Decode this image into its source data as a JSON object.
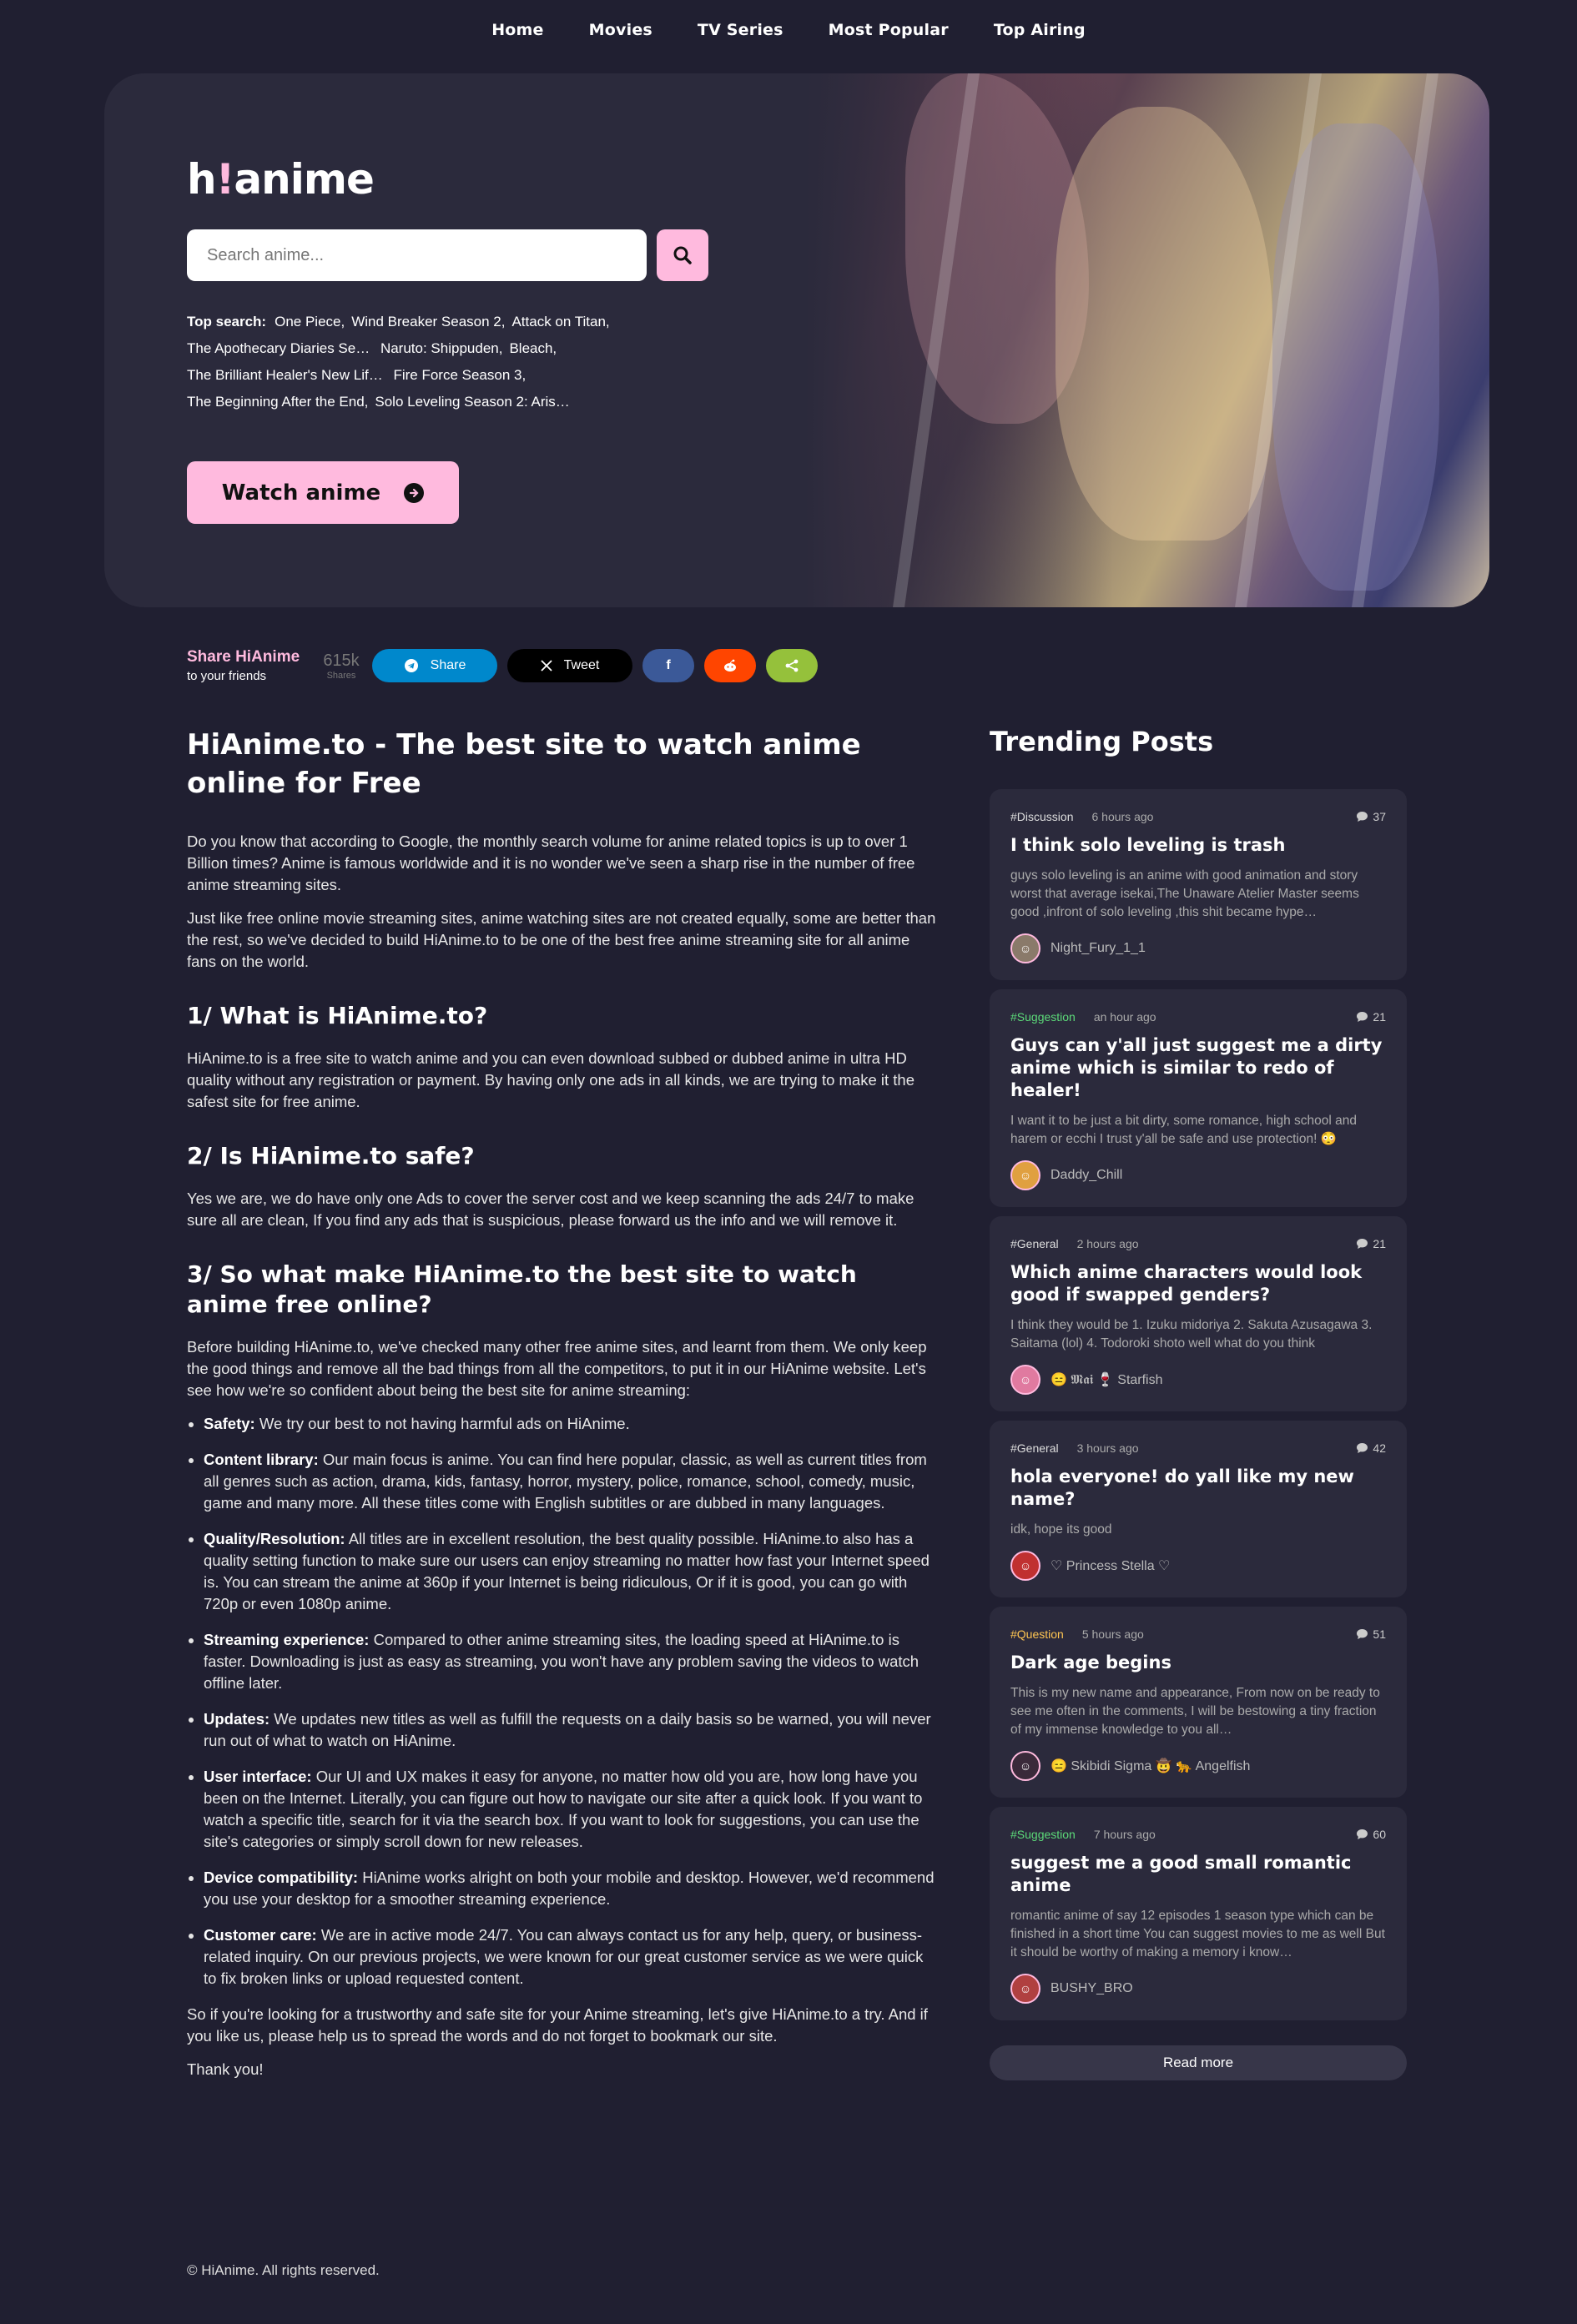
{
  "nav": {
    "items": [
      "Home",
      "Movies",
      "TV Series",
      "Most Popular",
      "Top Airing"
    ]
  },
  "hero": {
    "logo_h": "h",
    "logo_bang": "!",
    "logo_rest": "anime",
    "search_placeholder": "Search anime...",
    "top_search_label": "Top search:",
    "top_search": [
      "One Piece,",
      "Wind Breaker Season 2,",
      "Attack on Titan,",
      "The Apothecary Diaries Se…",
      "Naruto: Shippuden,",
      "Bleach,",
      "The Brilliant Healer's New Lif…",
      "Fire Force Season 3,",
      "The Beginning After the End,",
      "Solo Leveling Season 2: Aris…"
    ],
    "watch_label": "Watch anime"
  },
  "share": {
    "title": "Share HiAnime",
    "subtitle": "to your friends",
    "count": "615k",
    "count_label": "Shares",
    "telegram": "Share",
    "tweet": "Tweet"
  },
  "article": {
    "h1": "HiAnime.to - The best site to watch anime online for Free",
    "p1": "Do you know that according to Google, the monthly search volume for anime related topics is up to over 1 Billion times? Anime is famous worldwide and it is no wonder we've seen a sharp rise in the number of free anime streaming sites.",
    "p2": "Just like free online movie streaming sites, anime watching sites are not created equally, some are better than the rest, so we've decided to build HiAnime.to to be one of the best free anime streaming site for all anime fans on the world.",
    "h2a": "1/ What is HiAnime.to?",
    "p3": "HiAnime.to is a free site to watch anime and you can even download subbed or dubbed anime in ultra HD quality without any registration or payment. By having only one ads in all kinds, we are trying to make it the safest site for free anime.",
    "h2b": "2/ Is HiAnime.to safe?",
    "p4": "Yes we are, we do have only one Ads to cover the server cost and we keep scanning the ads 24/7 to make sure all are clean, If you find any ads that is suspicious, please forward us the info and we will remove it.",
    "h2c": "3/ So what make HiAnime.to the best site to watch anime free online?",
    "p5": "Before building HiAnime.to, we've checked many other free anime sites, and learnt from them. We only keep the good things and remove all the bad things from all the competitors, to put it in our HiAnime website. Let's see how we're so confident about being the best site for anime streaming:",
    "bullets": [
      {
        "k": "Safety:",
        "v": " We try our best to not having harmful ads on HiAnime."
      },
      {
        "k": "Content library:",
        "v": " Our main focus is anime. You can find here popular, classic, as well as current titles from all genres such as action, drama, kids, fantasy, horror, mystery, police, romance, school, comedy, music, game and many more. All these titles come with English subtitles or are dubbed in many languages."
      },
      {
        "k": "Quality/Resolution:",
        "v": " All titles are in excellent resolution, the best quality possible. HiAnime.to also has a quality setting function to make sure our users can enjoy streaming no matter how fast your Internet speed is. You can stream the anime at 360p if your Internet is being ridiculous, Or if it is good, you can go with 720p or even 1080p anime."
      },
      {
        "k": "Streaming experience:",
        "v": " Compared to other anime streaming sites, the loading speed at HiAnime.to is faster. Downloading is just as easy as streaming, you won't have any problem saving the videos to watch offline later."
      },
      {
        "k": "Updates:",
        "v": " We updates new titles as well as fulfill the requests on a daily basis so be warned, you will never run out of what to watch on HiAnime."
      },
      {
        "k": "User interface:",
        "v": " Our UI and UX makes it easy for anyone, no matter how old you are, how long have you been on the Internet. Literally, you can figure out how to navigate our site after a quick look. If you want to watch a specific title, search for it via the search box. If you want to look for suggestions, you can use the site's categories or simply scroll down for new releases."
      },
      {
        "k": "Device compatibility:",
        "v": " HiAnime works alright on both your mobile and desktop. However, we'd recommend you use your desktop for a smoother streaming experience."
      },
      {
        "k": "Customer care:",
        "v": " We are in active mode 24/7. You can always contact us for any help, query, or business-related inquiry. On our previous projects, we were known for our great customer service as we were quick to fix broken links or upload requested content."
      }
    ],
    "p6": "So if you're looking for a trustworthy and safe site for your Anime streaming, let's give HiAnime.to a try. And if you like us, please help us to spread the words and do not forget to bookmark our site.",
    "p7": "Thank you!"
  },
  "trending": {
    "title": "Trending Posts",
    "read_more": "Read more",
    "posts": [
      {
        "tag": "#Discussion",
        "tag_class": "discussion",
        "time": "6 hours ago",
        "comments": "37",
        "title": "I think solo leveling is trash",
        "body": "guys solo leveling is an anime with good animation and story worst that average isekai,The Unaware Atelier Master seems good ,infront of solo leveling ,this shit became hype…",
        "author": "Night_Fury_1_1",
        "avatar_color": "#8a7a6a"
      },
      {
        "tag": "#Suggestion",
        "tag_class": "suggestion",
        "time": "an hour ago",
        "comments": "21",
        "title": "Guys can y'all just suggest me a dirty anime which is similar to redo of healer!",
        "body": "I want it to be just a bit dirty, some romance, high school and harem or ecchi I trust y'all be safe and use protection! 😳",
        "author": "Daddy_Chill",
        "avatar_color": "#e0a040"
      },
      {
        "tag": "#General",
        "tag_class": "general",
        "time": "2 hours ago",
        "comments": "21",
        "title": "Which anime characters would look good if swapped genders?",
        "body": "I think they would be 1. Izuku midoriya 2. Sakuta Azusagawa 3. Saitama (lol) 4. Todoroki shoto well what do you think",
        "author": "😑 𝕸𝖆𝖎 🍷 Starfish",
        "avatar_color": "#e07aa0"
      },
      {
        "tag": "#General",
        "tag_class": "general",
        "time": "3 hours ago",
        "comments": "42",
        "title": "hola everyone! do yall like my new name?",
        "body": "idk, hope its good",
        "author": "♡ Princess Stella ♡",
        "avatar_color": "#c03030"
      },
      {
        "tag": "#Question",
        "tag_class": "question",
        "time": "5 hours ago",
        "comments": "51",
        "title": "Dark age begins",
        "body": "This is my new name and appearance, From now on be ready to see me often in the comments, I will be bestowing a tiny fraction of my immense knowledge to you all…",
        "author": "😑 Skibidi Sigma 🤠 🐆 Angelfish",
        "avatar_color": "#3a2a3a"
      },
      {
        "tag": "#Suggestion",
        "tag_class": "suggestion",
        "time": "7 hours ago",
        "comments": "60",
        "title": "suggest me a good small romantic anime",
        "body": "romantic anime of say 12 episodes 1 season type which can be finished in a short time You can suggest movies to me as well But it should be worthy of making a memory i know…",
        "author": "BUSHY_BRO",
        "avatar_color": "#b04040"
      }
    ]
  },
  "footer": "© HiAnime. All rights reserved."
}
